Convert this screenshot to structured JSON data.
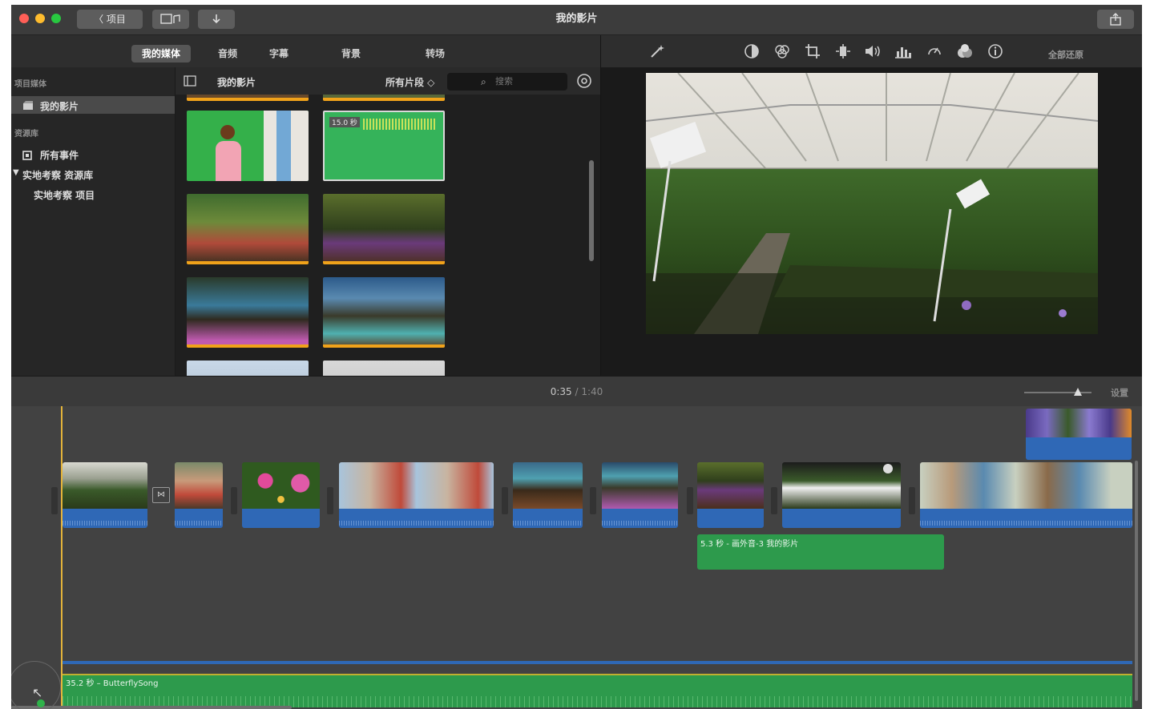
{
  "window": {
    "title": "我的影片",
    "back_label": "〈 项目",
    "media_toggle_icon": "media-toggle-icon",
    "import_icon": "import-arrow-icon",
    "share_icon": "share-icon"
  },
  "browser_tabs": [
    "我的媒体",
    "音频",
    "字幕",
    "背景",
    "转场"
  ],
  "sidebar": {
    "projects_header": "项目媒体",
    "project_item": "我的影片",
    "library_header": "资源库",
    "all_events": "所有事件",
    "library_name": "实地考察 资源库",
    "library_project": "实地考察 项目"
  },
  "media_bar": {
    "title": "我的影片",
    "filter": "所有片段 ◇",
    "search_placeholder": "搜索"
  },
  "media_thumbs": [
    {
      "kind": "green-girl"
    },
    {
      "kind": "green-audio",
      "badge": "15.0 秒"
    },
    {
      "kind": "group"
    },
    {
      "kind": "planting"
    },
    {
      "kind": "flowers-hands"
    },
    {
      "kind": "boots"
    }
  ],
  "viewer_tools": {
    "reset_all": "全部还原"
  },
  "timeline": {
    "current_time": "0:35",
    "separator": "/",
    "total_time": "1:40",
    "settings": "设置",
    "zoom": 0.8,
    "overlay_clip_label": "5.3 秒 - 画外音-3 我的影片",
    "music_label": "35.2 秒 – ButterflySong"
  },
  "colors": {
    "audio_blue": "#2f68b6",
    "music_green": "#2d9a4c",
    "playhead": "#e4b33a",
    "selected_orange": "#f0a21a"
  }
}
